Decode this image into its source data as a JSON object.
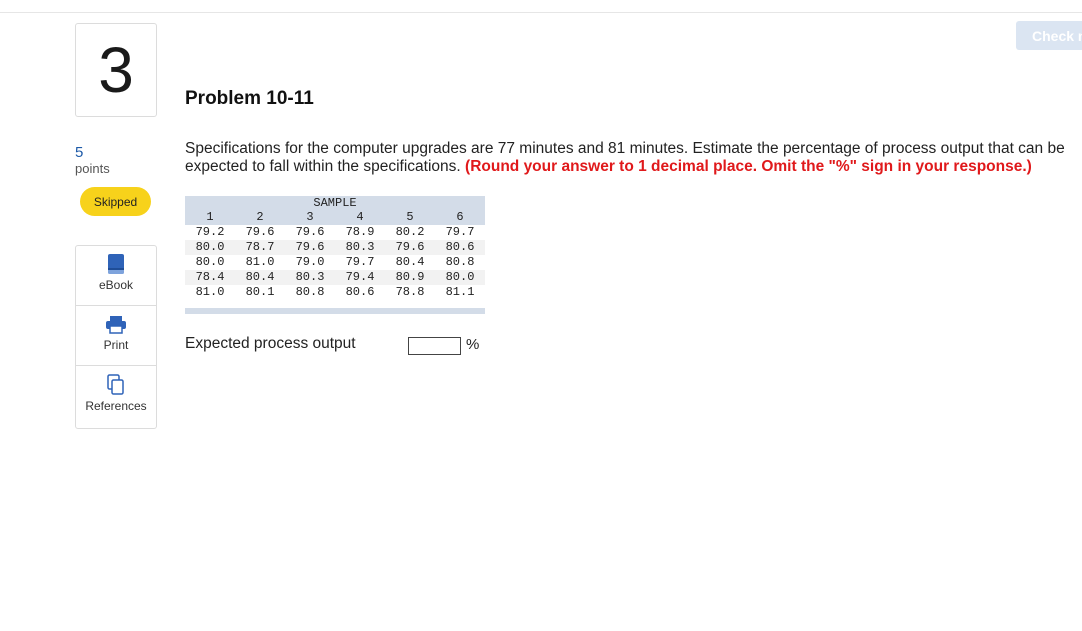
{
  "question": {
    "number": "3",
    "points_value": "5",
    "points_label": "points",
    "status": "Skipped"
  },
  "tools": [
    {
      "label": "eBook",
      "icon": "book-icon"
    },
    {
      "label": "Print",
      "icon": "printer-icon"
    },
    {
      "label": "References",
      "icon": "references-icon"
    }
  ],
  "header": {
    "check_button_label": "Check m"
  },
  "problem": {
    "title": "Problem 10-11",
    "prompt_line1": "Specifications for the computer upgrades are 77 minutes and 81 minutes. Estimate the percentage of process output that can be",
    "prompt_line2": "expected to fall within the specifications.",
    "instruction": "(Round your answer to 1 decimal place. Omit the \"%\" sign in your response.)"
  },
  "sample_table": {
    "header": "SAMPLE",
    "columns": [
      "1",
      "2",
      "3",
      "4",
      "5",
      "6"
    ],
    "rows": [
      [
        "79.2",
        "79.6",
        "79.6",
        "78.9",
        "80.2",
        "79.7"
      ],
      [
        "80.0",
        "78.7",
        "79.6",
        "80.3",
        "79.6",
        "80.6"
      ],
      [
        "80.0",
        "81.0",
        "79.0",
        "79.7",
        "80.4",
        "80.8"
      ],
      [
        "78.4",
        "80.4",
        "80.3",
        "79.4",
        "80.9",
        "80.0"
      ],
      [
        "81.0",
        "80.1",
        "80.8",
        "80.6",
        "78.8",
        "81.1"
      ]
    ]
  },
  "answer": {
    "label": "Expected process output",
    "value": "",
    "unit": "%"
  },
  "colors": {
    "accent_blue": "#1d5aa8",
    "skipped_badge": "#f7d21b",
    "instruction_red": "#e0191b",
    "table_header": "#d3dce8",
    "check_button": "#dbe5f2"
  }
}
